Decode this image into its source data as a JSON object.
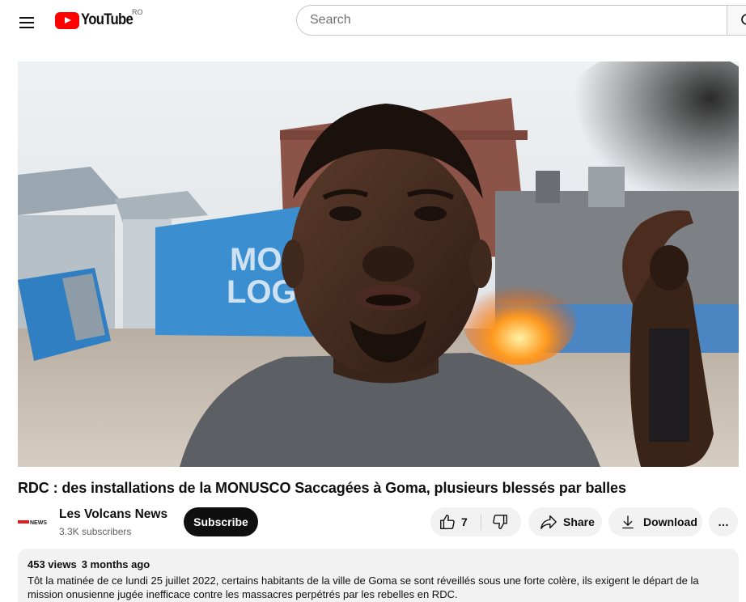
{
  "header": {
    "logo_text": "YouTube",
    "country_code": "RO",
    "search_placeholder": "Search"
  },
  "player": {
    "wall_text_line1": "MO",
    "wall_text_line2": "LOG"
  },
  "video": {
    "title": "RDC : des installations de la MONUSCO Saccagées à Goma, plusieurs blessés par balles"
  },
  "channel": {
    "name": "Les Volcans News",
    "subscribers": "3.3K subscribers",
    "avatar_text": "NEWS",
    "subscribe_label": "Subscribe"
  },
  "actions": {
    "like_count": "7",
    "share_label": "Share",
    "download_label": "Download",
    "more_label": "…"
  },
  "description": {
    "views": "453 views",
    "date": "3 months ago",
    "text": "Tôt la matinée de ce lundi 25 juillet 2022, certains habitants de la ville de Goma se sont réveillés sous une forte colère, ils exigent le départ de la mission onusienne jugée inefficace contre les massacres perpétrés par les rebelles en RDC."
  },
  "icons": {
    "menu": "menu-icon",
    "search": "search-icon",
    "like": "thumbs-up-icon",
    "dislike": "thumbs-down-icon",
    "share": "share-arrow-icon",
    "download": "download-icon",
    "more": "more-horizontal-icon"
  },
  "colors": {
    "brand_red": "#ff0000",
    "subscribe_bg": "#0f0f0f",
    "pill_bg": "#f2f2f2",
    "wall_blue": "#3b8fd0"
  }
}
